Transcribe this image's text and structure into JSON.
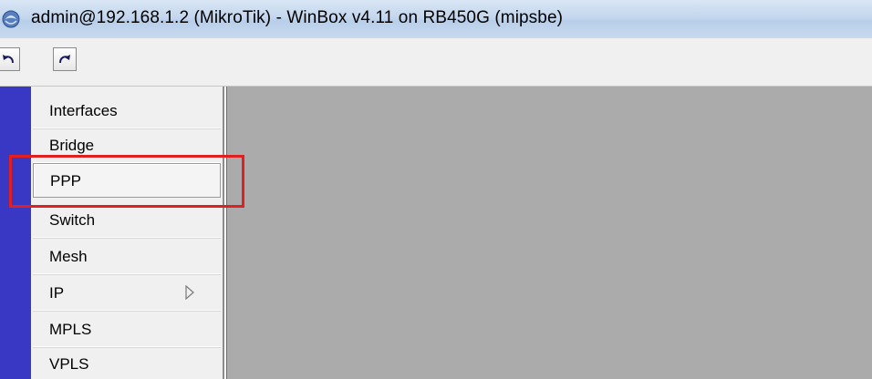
{
  "window": {
    "title": "admin@192.168.1.2 (MikroTik) - WinBox v4.11 on RB450G (mipsbe)",
    "icon": "winbox-app-icon"
  },
  "toolbar": {
    "undo_icon": "undo-icon",
    "redo_icon": "redo-icon"
  },
  "menu": {
    "items": [
      {
        "label": "Interfaces"
      },
      {
        "label": "Bridge"
      },
      {
        "label": "PPP",
        "selected": true
      },
      {
        "label": "Switch"
      },
      {
        "label": "Mesh"
      },
      {
        "label": "IP",
        "submenu_icon": "submenu-arrow-icon"
      },
      {
        "label": "MPLS"
      },
      {
        "label": "VPLS"
      }
    ]
  },
  "colors": {
    "sidebar_strip": "#3838c4",
    "workspace": "#ababab",
    "highlight": "#e02020",
    "menu_bg": "#f0f0f0"
  }
}
